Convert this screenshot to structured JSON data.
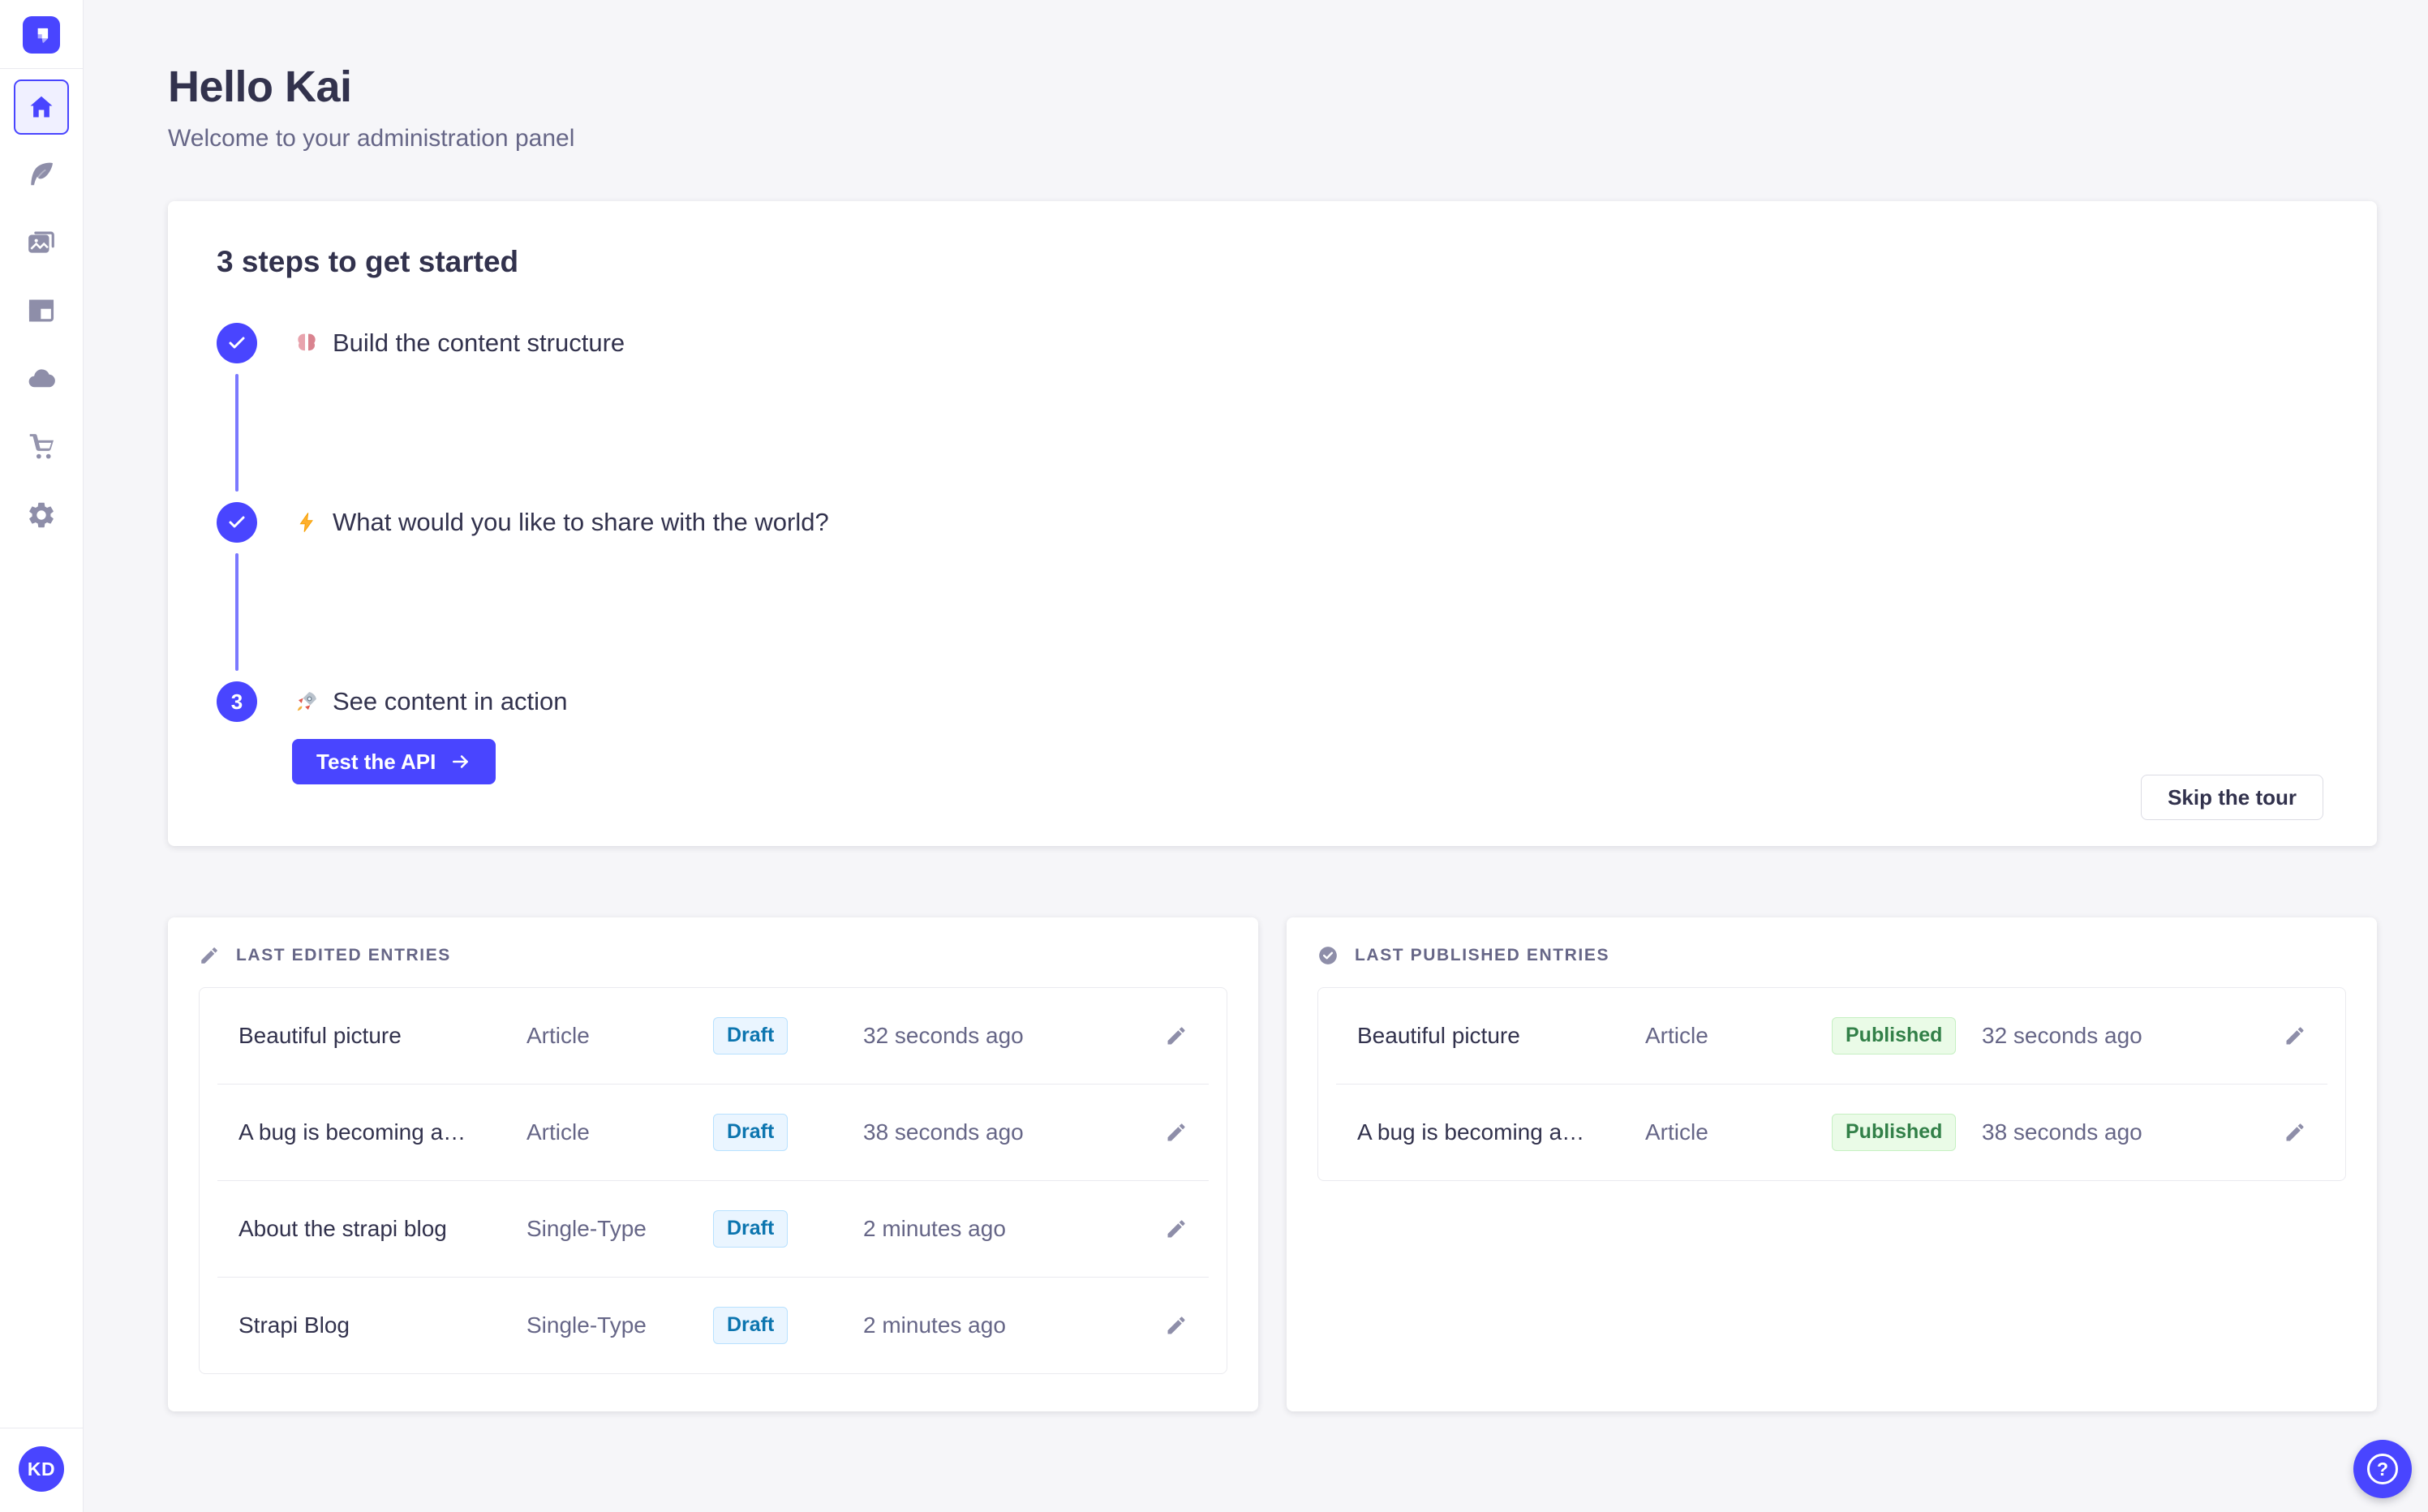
{
  "colors": {
    "primary": "#4945FF",
    "primary_light": "#7B79FF",
    "page_background": "#F6F6F9",
    "draft_badge_bg": "#EAF5FF",
    "draft_badge_text": "#0C75AF",
    "published_badge_bg": "#EAFBE7",
    "published_badge_text": "#328048"
  },
  "sidebar": {
    "logo_icon": "strapi-logo-icon",
    "items": [
      {
        "icon": "home-icon",
        "active": true
      },
      {
        "icon": "content-manager-feather-icon",
        "active": false
      },
      {
        "icon": "media-library-icon",
        "active": false
      },
      {
        "icon": "content-type-builder-icon",
        "active": false
      },
      {
        "icon": "cloud-icon",
        "active": false
      },
      {
        "icon": "marketplace-cart-icon",
        "active": false
      },
      {
        "icon": "settings-gear-icon",
        "active": false
      }
    ],
    "user_initials": "KD"
  },
  "header": {
    "title": "Hello Kai",
    "subtitle": "Welcome to your administration panel"
  },
  "onboarding": {
    "title": "3 steps to get started",
    "steps": [
      {
        "emoji": "🧠",
        "label": "Build the content structure",
        "status": "done"
      },
      {
        "emoji": "⚡",
        "label": "What would you like to share with the world?",
        "status": "done"
      },
      {
        "emoji": "🚀",
        "label": "See content in action",
        "status": "current",
        "number": "3"
      }
    ],
    "cta_label": "Test the API",
    "skip_label": "Skip the tour"
  },
  "last_edited": {
    "label": "LAST EDITED ENTRIES",
    "entries": [
      {
        "title": "Beautiful picture",
        "type": "Article",
        "status": "Draft",
        "time": "32 seconds ago"
      },
      {
        "title": "A bug is becoming a…",
        "type": "Article",
        "status": "Draft",
        "time": "38 seconds ago"
      },
      {
        "title": "About the strapi blog",
        "type": "Single-Type",
        "status": "Draft",
        "time": "2 minutes ago"
      },
      {
        "title": "Strapi Blog",
        "type": "Single-Type",
        "status": "Draft",
        "time": "2 minutes ago"
      }
    ]
  },
  "last_published": {
    "label": "LAST PUBLISHED ENTRIES",
    "entries": [
      {
        "title": "Beautiful picture",
        "type": "Article",
        "status": "Published",
        "time": "32 seconds ago"
      },
      {
        "title": "A bug is becoming a…",
        "type": "Article",
        "status": "Published",
        "time": "38 seconds ago"
      }
    ]
  },
  "help": {
    "glyph": "?"
  }
}
